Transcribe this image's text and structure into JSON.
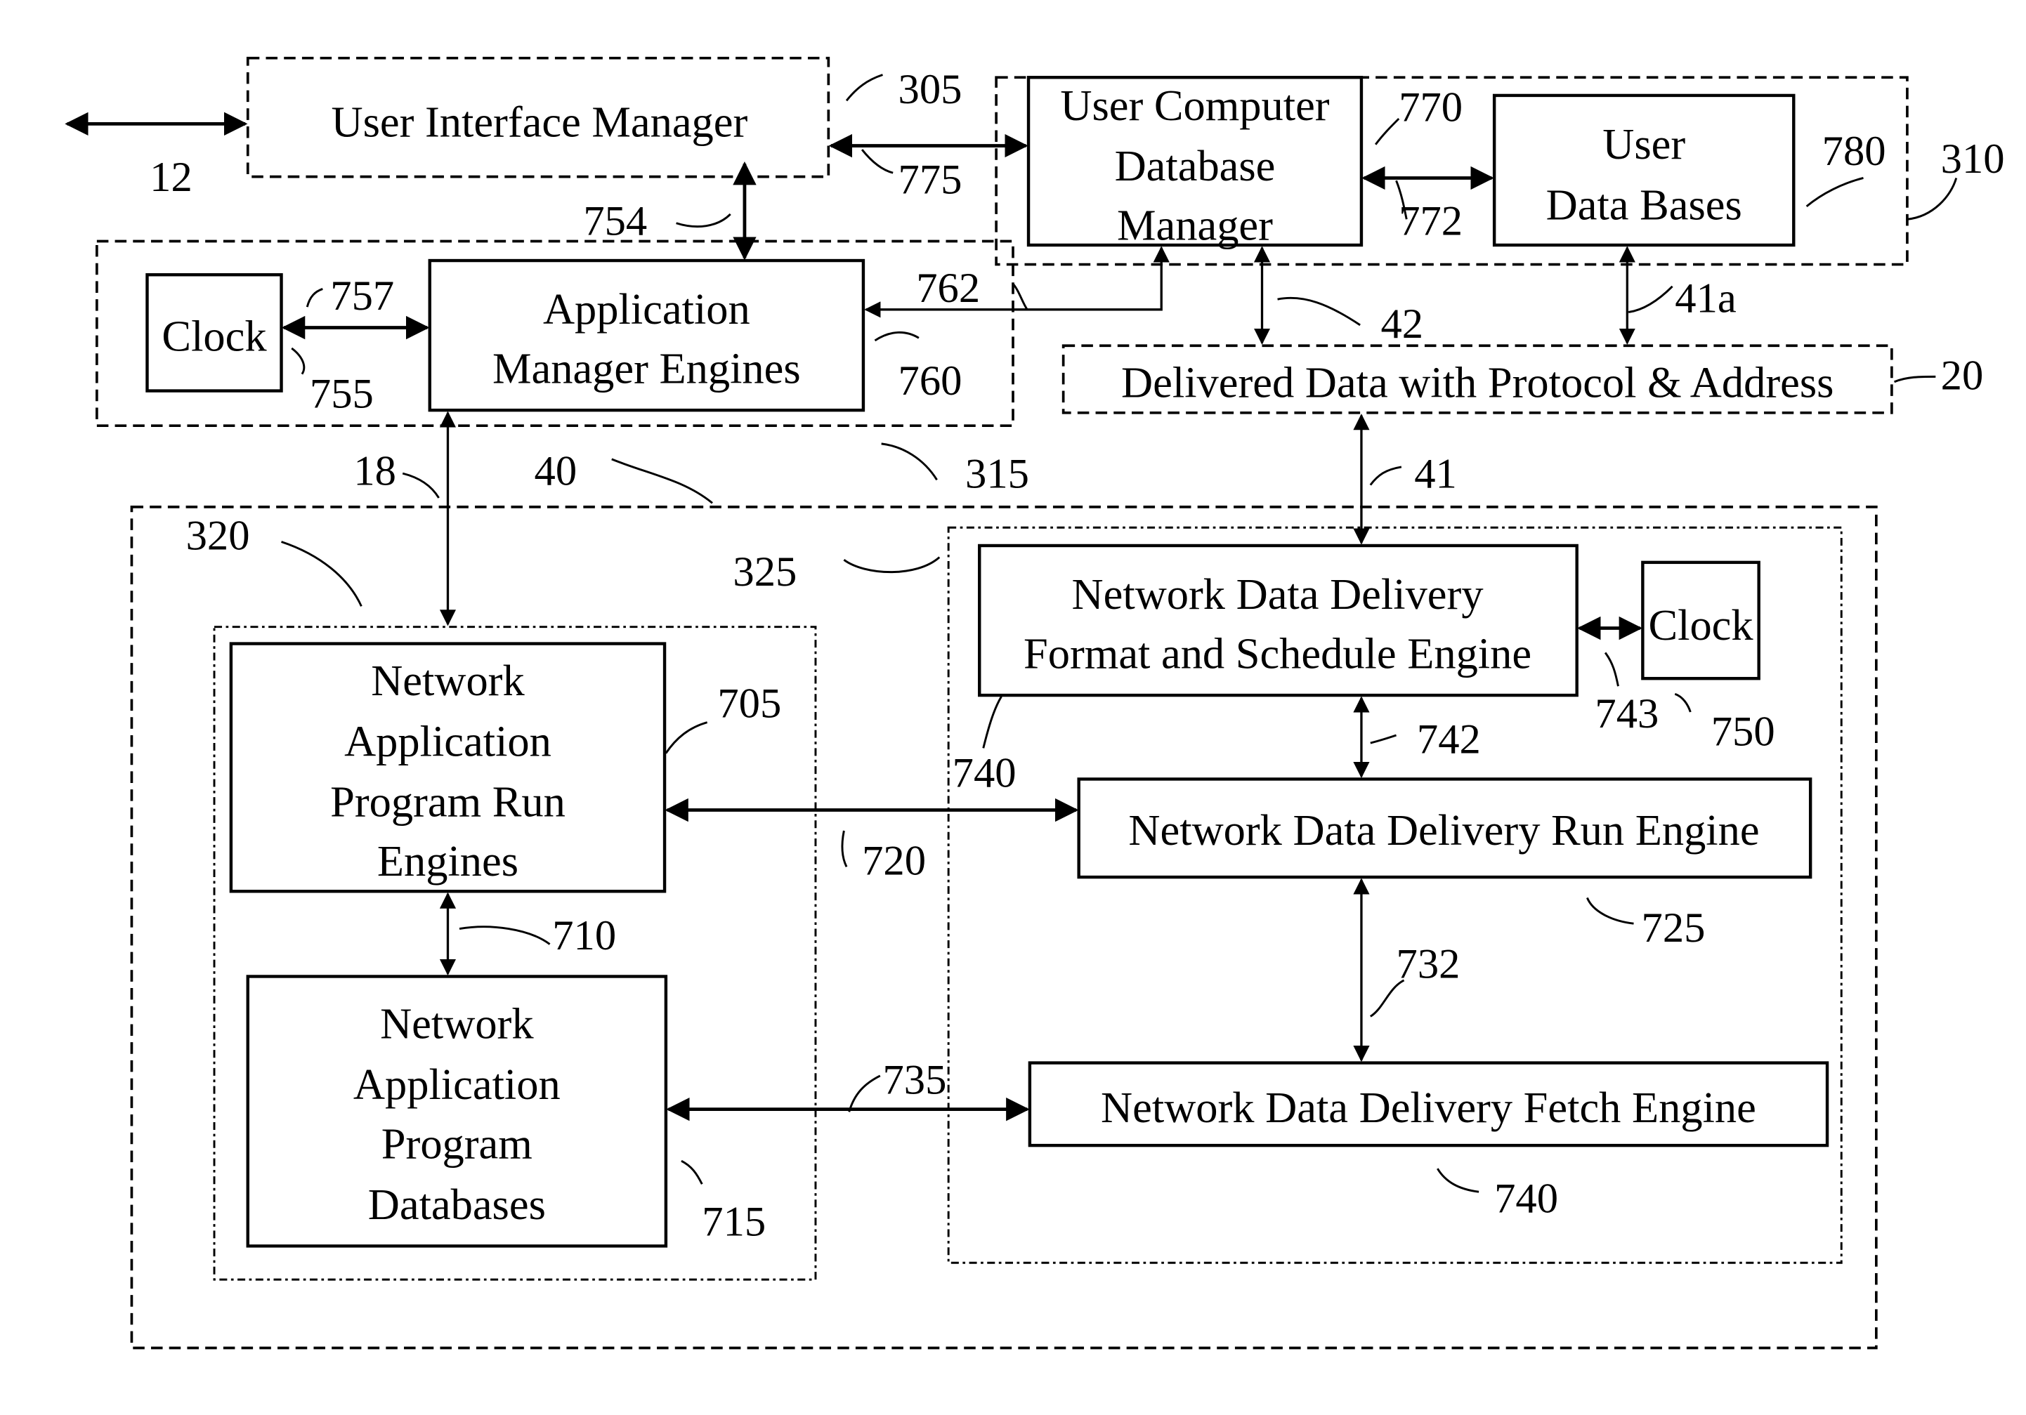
{
  "diagram": {
    "blocks": {
      "user_interface_manager": "User Interface Manager",
      "user_computer_db_manager": [
        "User Computer",
        "Database",
        "Manager"
      ],
      "user_data_bases": [
        "User",
        "Data Bases"
      ],
      "clock_top": "Clock",
      "application_manager_engines": [
        "Application",
        "Manager Engines"
      ],
      "delivered_data": "Delivered Data with Protocol & Address",
      "net_app_run_engines": [
        "Network",
        "Application",
        "Program Run",
        "Engines"
      ],
      "net_app_databases": [
        "Network",
        "Application",
        "Program",
        "Databases"
      ],
      "ndd_format_schedule": [
        "Network Data Delivery",
        "Format  and Schedule Engine"
      ],
      "clock_bottom": "Clock",
      "ndd_run_engine": "Network Data Delivery Run Engine",
      "ndd_fetch_engine": "Network Data Delivery Fetch Engine"
    },
    "refs": {
      "r12": "12",
      "r305": "305",
      "r775": "775",
      "r754": "754",
      "r770": "770",
      "r772": "772",
      "r780": "780",
      "r310": "310",
      "r757": "757",
      "r755": "755",
      "r762": "762",
      "r760": "760",
      "r42": "42",
      "r41a": "41a",
      "r20": "20",
      "r18": "18",
      "r40": "40",
      "r315": "315",
      "r41": "41",
      "r320": "320",
      "r325": "325",
      "r705": "705",
      "r740a": "740",
      "r742": "742",
      "r743": "743",
      "r750": "750",
      "r720": "720",
      "r725": "725",
      "r710": "710",
      "r732": "732",
      "r735": "735",
      "r715": "715",
      "r740b": "740"
    }
  }
}
